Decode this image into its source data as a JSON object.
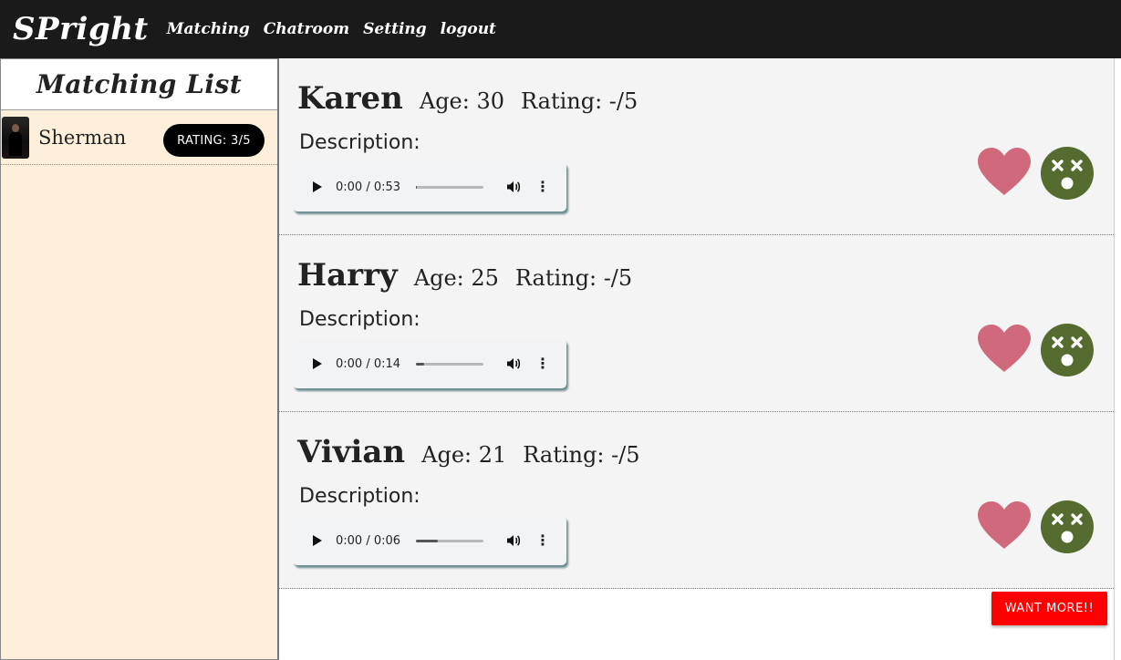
{
  "navbar": {
    "brand": "SPright",
    "links": [
      "Matching",
      "Chatroom",
      "Setting",
      "logout"
    ]
  },
  "sidebar": {
    "title": "Matching List",
    "items": [
      {
        "name": "Sherman",
        "rating": "RATING: 3/5"
      }
    ]
  },
  "cards": [
    {
      "name": "Karen",
      "age": "Age: 30",
      "rating": "Rating: -/5",
      "description_label": "Description:",
      "time": "0:00 / 0:53",
      "progress": 0.02
    },
    {
      "name": "Harry",
      "age": "Age: 25",
      "rating": "Rating: -/5",
      "description_label": "Description:",
      "time": "0:00 / 0:14",
      "progress": 0.12
    },
    {
      "name": "Vivian",
      "age": "Age: 21",
      "rating": "Rating: -/5",
      "description_label": "Description:",
      "time": "0:00 / 0:06",
      "progress": 0.32
    }
  ],
  "want_more_label": "WANT MORE!!",
  "colors": {
    "navbar_bg": "#1a1a1a",
    "sidebar_bg": "#fdefda",
    "heart": "#d0697c",
    "dislike": "#556b2f",
    "want_more": "#ff0000"
  },
  "icons": {
    "like": "heart-icon",
    "dislike": "dizzy-face-icon",
    "play": "play-icon",
    "volume": "volume-icon",
    "more": "more-vert-icon"
  }
}
